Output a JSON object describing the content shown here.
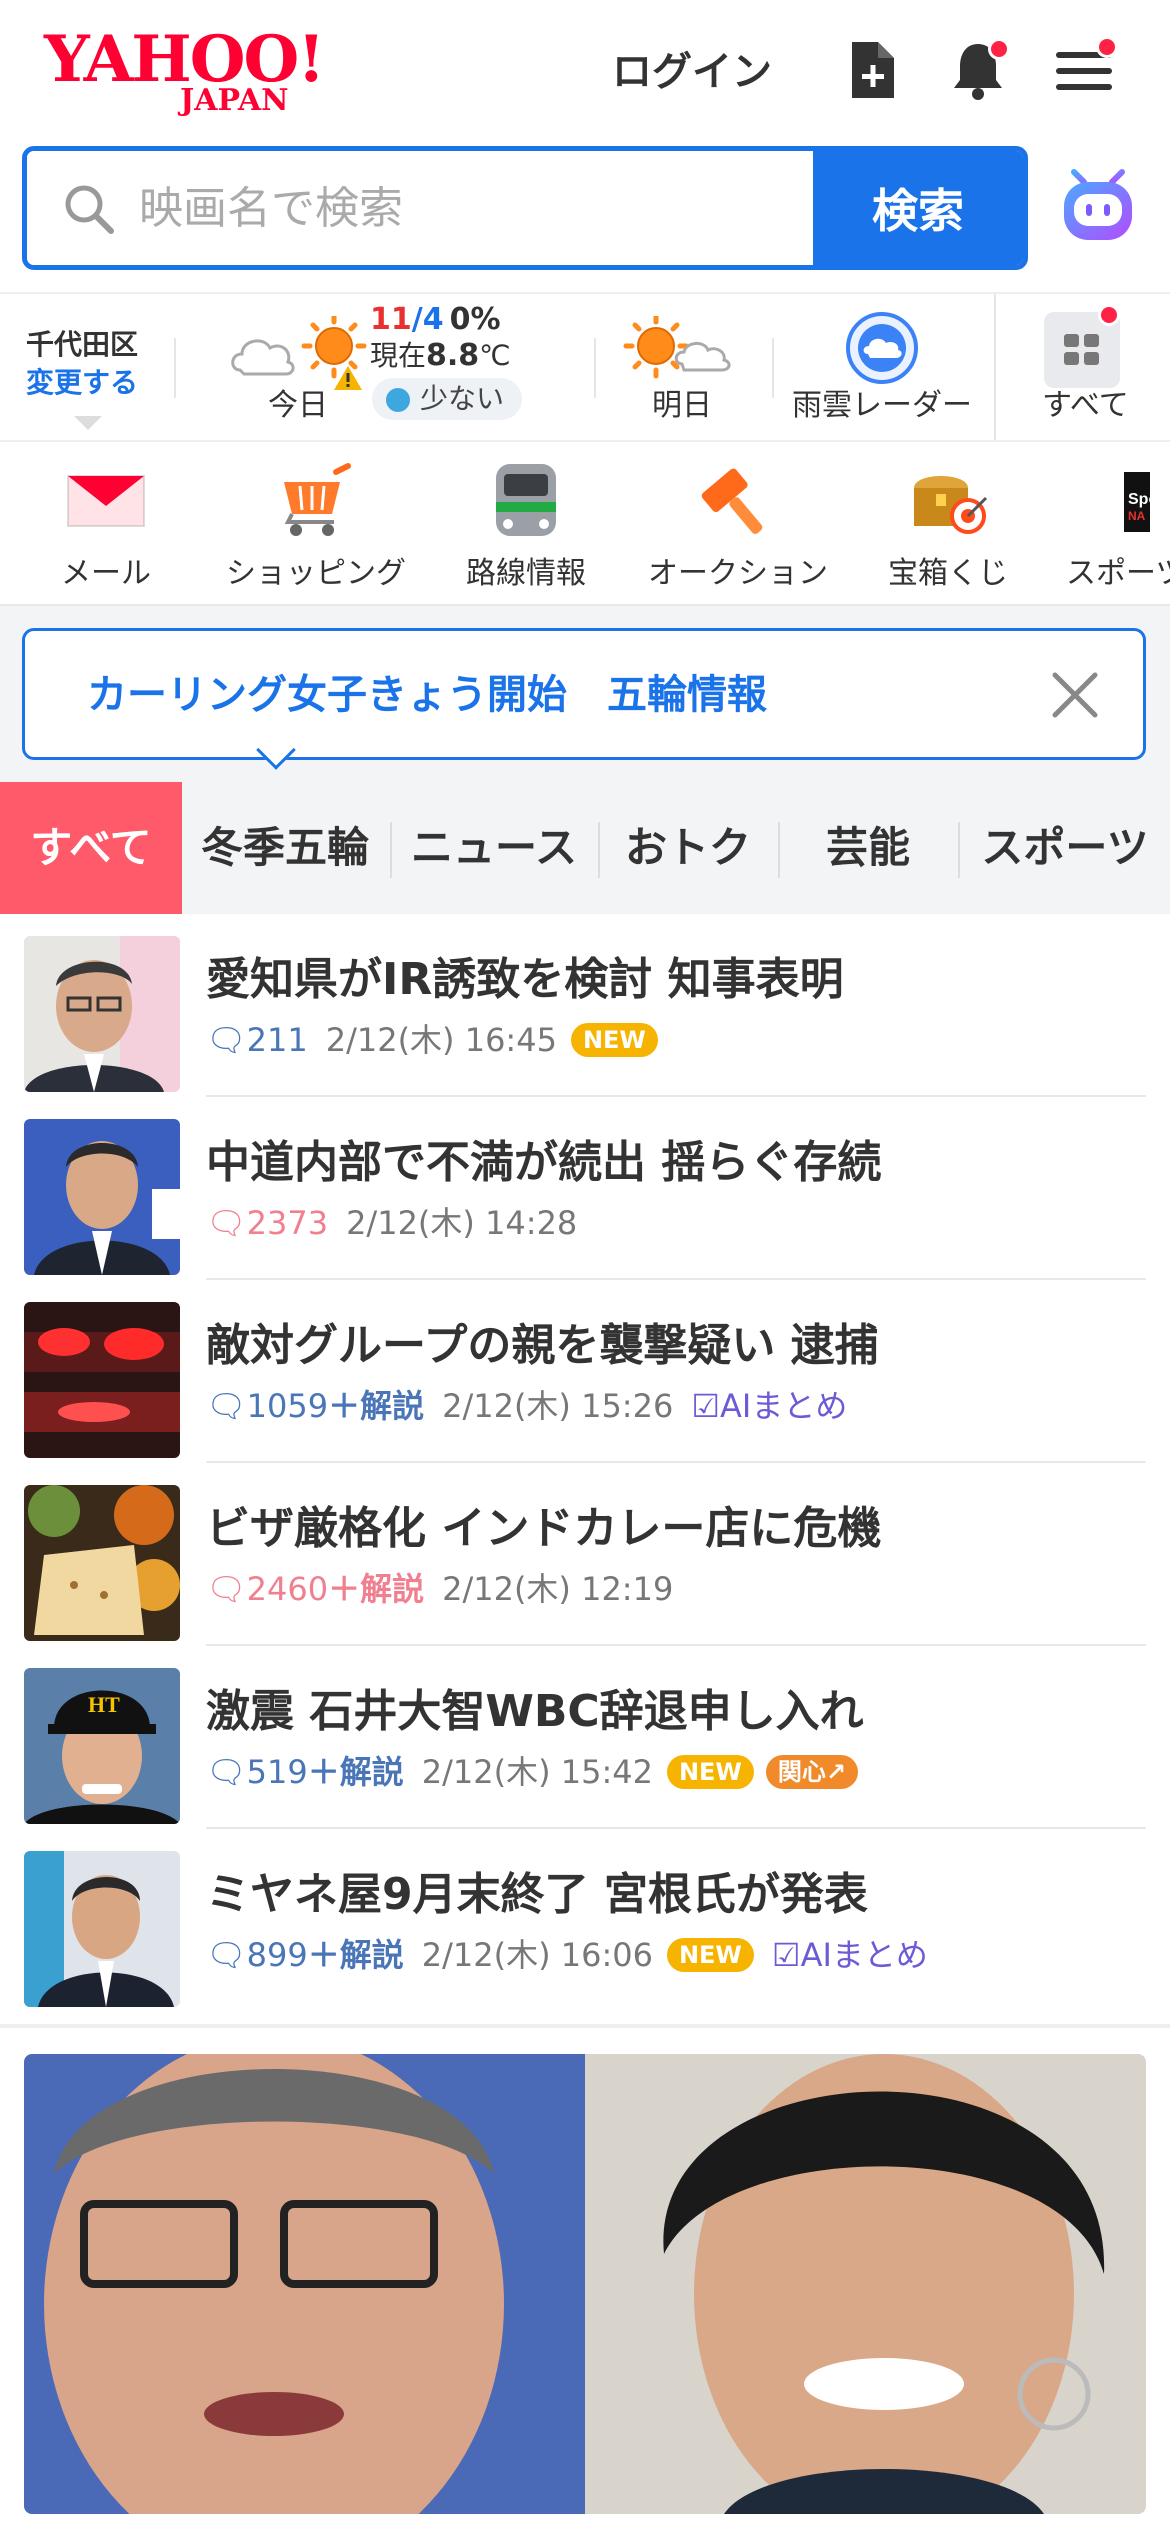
{
  "header": {
    "logo_main": "YAHOO!",
    "logo_sub": "JAPAN",
    "login": "ログイン",
    "icons": [
      "document-add-icon",
      "bell-icon",
      "menu-icon"
    ],
    "brand_color": "#ff0033"
  },
  "search": {
    "placeholder": "映画名で検索",
    "button": "検索",
    "accent": "#1a73e8"
  },
  "weather": {
    "location": "千代田区",
    "change": "変更する",
    "today_label": "今日",
    "temp_high": "11",
    "temp_sep": "/",
    "temp_low": "4",
    "precip": "0%",
    "now_prefix": "現在",
    "now_temp": "8.8",
    "now_unit": "℃",
    "pollen": "少ない",
    "tomorrow_label": "明日",
    "radar_label": "雨雲レーダー",
    "all_label": "すべて"
  },
  "services": [
    {
      "label": "メール",
      "icon": "mail-icon"
    },
    {
      "label": "ショッピング",
      "icon": "shopping-cart-icon"
    },
    {
      "label": "路線情報",
      "icon": "train-icon"
    },
    {
      "label": "オークション",
      "icon": "auction-gavel-icon"
    },
    {
      "label": "宝箱くじ",
      "icon": "treasure-box-icon"
    },
    {
      "label": "スポーツ",
      "icon": "sports-icon"
    }
  ],
  "ticker": {
    "text": "カーリング女子きょう開始　五輪情報"
  },
  "tabs": [
    "すべて",
    "冬季五輪",
    "ニュース",
    "おトク",
    "芸能",
    "スポーツ"
  ],
  "news": [
    {
      "title": "愛知県がIR誘致を検討 知事表明",
      "comments": "211",
      "kaisetsu": "",
      "date": "2/12(木) 16:45",
      "badge_new": "NEW",
      "badge_kanshin": "",
      "ai": "",
      "red": false
    },
    {
      "title": "中道内部で不満が続出 揺らぐ存続",
      "comments": "2373",
      "kaisetsu": "",
      "date": "2/12(木) 14:28",
      "badge_new": "",
      "badge_kanshin": "",
      "ai": "",
      "red": true
    },
    {
      "title": "敵対グループの親を襲撃疑い 逮捕",
      "comments": "1059",
      "kaisetsu": "＋解説",
      "date": "2/12(木) 15:26",
      "badge_new": "",
      "badge_kanshin": "",
      "ai": "AIまとめ",
      "red": false
    },
    {
      "title": "ビザ厳格化 インドカレー店に危機",
      "comments": "2460",
      "kaisetsu": "＋解説",
      "date": "2/12(木) 12:19",
      "badge_new": "",
      "badge_kanshin": "",
      "ai": "",
      "red": true
    },
    {
      "title": "激震 石井大智WBC辞退申し入れ",
      "comments": "519",
      "kaisetsu": "＋解説",
      "date": "2/12(木) 15:42",
      "badge_new": "NEW",
      "badge_kanshin": "関心",
      "ai": "",
      "red": false
    },
    {
      "title": "ミヤネ屋9月末終了 宮根氏が発表",
      "comments": "899",
      "kaisetsu": "＋解説",
      "date": "2/12(木) 16:06",
      "badge_new": "NEW",
      "badge_kanshin": "",
      "ai": "AIまとめ",
      "red": false
    }
  ]
}
